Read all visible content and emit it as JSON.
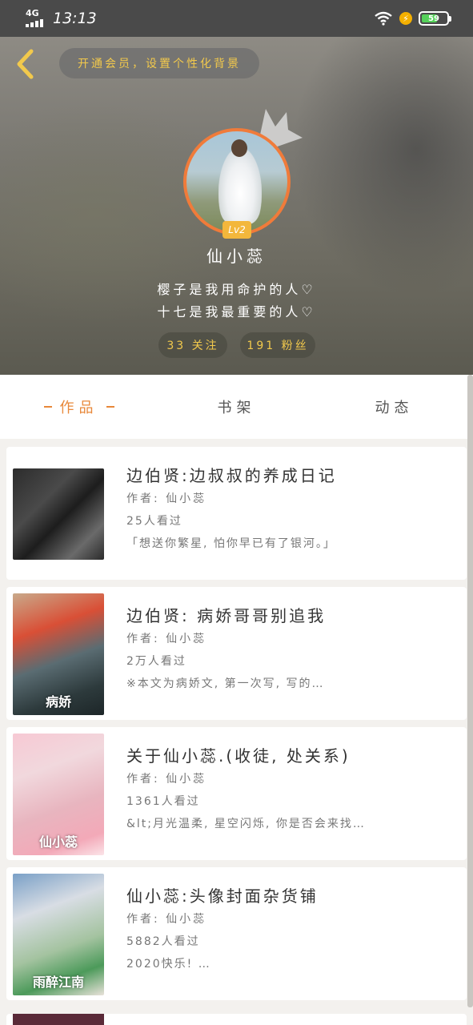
{
  "status_bar": {
    "network": "4G",
    "time": "13:13",
    "battery": "59"
  },
  "header": {
    "vip_prompt": "开通会员，设置个性化背景",
    "level": "Lv2",
    "username": "仙小蕊",
    "bio_line1": "樱子是我用命护的人♡",
    "bio_line2": "十七是我最重要的人♡",
    "following": "33 关注",
    "fans": "191 粉丝"
  },
  "tabs": [
    {
      "label": "作品",
      "active": true
    },
    {
      "label": "书架",
      "active": false
    },
    {
      "label": "动态",
      "active": false
    }
  ],
  "works": [
    {
      "title": "边伯贤:边叔叔的养成日记",
      "author": "作者: 仙小蕊",
      "views": "25人看过",
      "desc": "「想送你繁星, 怕你早已有了银河。」",
      "cover_caption": ""
    },
    {
      "title": "边伯贤:  病娇哥哥别追我",
      "author": "作者: 仙小蕊",
      "views": "2万人看过",
      "desc": "※本文为病娇文, 第一次写, 写的…",
      "cover_caption": "病娇"
    },
    {
      "title": "关于仙小蕊.(收徒, 处关系)",
      "author": "作者: 仙小蕊",
      "views": "1361人看过",
      "desc": "&lt;月光温柔, 星空闪烁, 你是否会来找…",
      "cover_caption": "仙小蕊"
    },
    {
      "title": "仙小蕊:头像封面杂货铺",
      "author": "作者: 仙小蕊",
      "views": "5882人看过",
      "desc": "2020快乐! …",
      "cover_caption": "雨醉江南"
    }
  ],
  "colors": {
    "accent": "#e8883a",
    "gold": "#f2c94c",
    "status_bar": "#4a4a4a"
  }
}
